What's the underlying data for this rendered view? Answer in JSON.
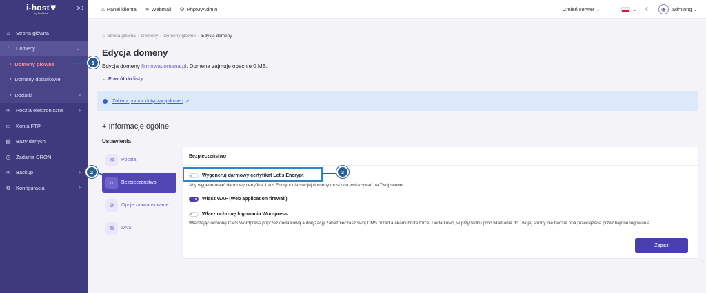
{
  "sidebar": {
    "logo": "i-host",
    "logo_sub": "by ProHost",
    "items": [
      {
        "label": "Strona główna",
        "icon": "home-icon",
        "glyph": "⌂"
      },
      {
        "label": "Domeny",
        "icon": "chart-icon",
        "glyph": "⫶"
      },
      {
        "label": "Domeny główne",
        "current": true
      },
      {
        "label": "Domeny dodatkowe"
      },
      {
        "label": "Dodatki"
      },
      {
        "label": "Poczta elektroniczna",
        "icon": "mail-icon",
        "glyph": "✉"
      },
      {
        "label": "Konta FTP",
        "icon": "folder-icon",
        "glyph": "▭"
      },
      {
        "label": "Bazy danych",
        "icon": "database-icon",
        "glyph": "▤"
      },
      {
        "label": "Zadania CRON",
        "icon": "clock-icon",
        "glyph": "◷"
      },
      {
        "label": "Backup",
        "icon": "backup-icon",
        "glyph": "✉"
      },
      {
        "label": "Konfiguracja",
        "icon": "gear-icon",
        "glyph": "⚙"
      }
    ]
  },
  "topbar": {
    "links": [
      "Panel klienta",
      "Webmail",
      "PhpMyAdmin"
    ],
    "server_select": "Zmień serwer",
    "user": "adminng"
  },
  "breadcrumb": [
    "Strona główna",
    "Domeny",
    "Domeny główne",
    "Edycja domeny"
  ],
  "page": {
    "title": "Edycja domeny",
    "desc_prefix": "Edycja domeny",
    "domain": "firmowadomena.pl",
    "desc_suffix": ". Domena zajmuje obecnie 0 MB.",
    "back": "Powrót do listy",
    "info_link": "Zobacz pomoc dotyczącą domen",
    "section": "Informacje ogólne",
    "settings": "Ustawienia"
  },
  "tabs": [
    {
      "label": "Poczta",
      "icon": "mail-icon",
      "glyph": "✉"
    },
    {
      "label": "Bezpieczeństwo",
      "icon": "lock-icon",
      "glyph": "⌂",
      "active": true
    },
    {
      "label": "Opcje zaawansowane",
      "icon": "gear-icon",
      "glyph": "⚙"
    },
    {
      "label": "DNS",
      "icon": "globe-icon",
      "glyph": "◍"
    }
  ],
  "panel": {
    "title": "Bezpieczeństwo",
    "opt1": "Wygeneruj darmowy certyfikat Let's Encrypt",
    "opt1_desc": "Aby wygenerować darmowy certyfikat Let's Encrypt dla swojej domeny musi ona wskazywać na Twój serwer",
    "opt2": "Włącz WAF (Web application firewall)",
    "opt3": "Włącz ochronę logowania Wordpress",
    "opt3_desc": "Włączając ochronę CMS Wordpress poprzez dodatkową autoryzację zabezpieczasz swój CMS przed atakami brute force. Dodatkowo, w przypadku prób włamania do Twojej strony nie będzie ona przeciążana przez błędne logowania.",
    "save": "Zapisz"
  },
  "badges": [
    "1",
    "2",
    "3"
  ]
}
